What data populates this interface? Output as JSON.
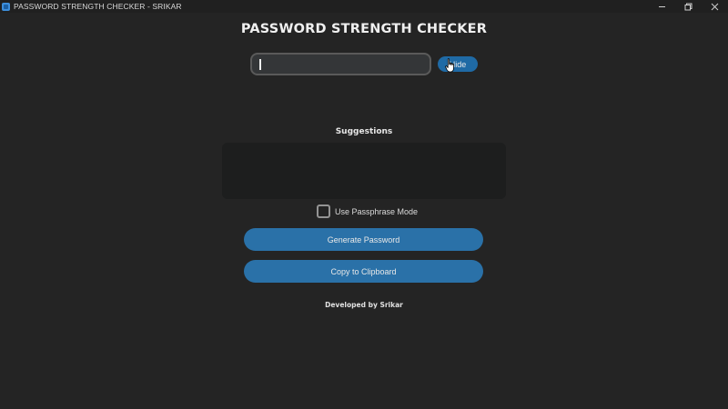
{
  "window": {
    "title": "PASSWORD STRENGTH CHECKER - SRIKAR",
    "icon": "app-icon",
    "controls": [
      "minimize-icon",
      "restore-icon",
      "close-icon"
    ]
  },
  "header": {
    "title": "PASSWORD STRENGTH CHECKER"
  },
  "password": {
    "value": "",
    "placeholder": "",
    "toggle_label": "Hide"
  },
  "suggestions": {
    "title": "Suggestions",
    "text": ""
  },
  "options": {
    "passphrase_label": "Use Passphrase Mode",
    "passphrase_checked": false
  },
  "actions": {
    "generate_label": "Generate Password",
    "copy_label": "Copy to Clipboard"
  },
  "footer": {
    "credit": "Developed by Srikar"
  },
  "colors": {
    "background": "#242424",
    "accent": "#1f6aa5",
    "button": "#2a71a8",
    "textbox": "#1d1e1e"
  }
}
